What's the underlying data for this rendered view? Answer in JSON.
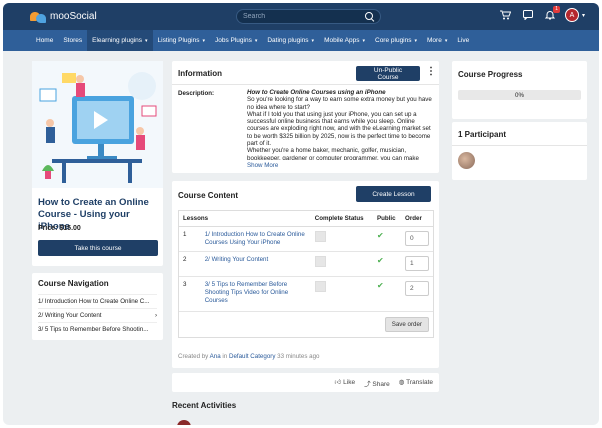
{
  "header": {
    "brand": "mooSocial",
    "search_placeholder": "Search",
    "notification_count": "1",
    "avatar_initial": "A"
  },
  "nav": [
    {
      "label": "Home",
      "caret": ""
    },
    {
      "label": "Stores",
      "caret": ""
    },
    {
      "label": "Elearning plugins",
      "caret": "▾",
      "active": true
    },
    {
      "label": "Listing Plugins",
      "caret": "▾"
    },
    {
      "label": "Jobs Plugins",
      "caret": "▾"
    },
    {
      "label": "Dating plugins",
      "caret": "▾"
    },
    {
      "label": "Mobile Apps",
      "caret": "▾"
    },
    {
      "label": "Core plugins",
      "caret": "▾"
    },
    {
      "label": "More",
      "caret": "▾"
    },
    {
      "label": "Live",
      "caret": ""
    }
  ],
  "course": {
    "title": "How to Create an Online Course - Using your iPhone",
    "price": "Price: $15.00",
    "take_button": "Take this course"
  },
  "course_navigation": {
    "title": "Course Navigation",
    "items": [
      "1/ Introduction How to Create Online C...",
      "2/ Writing Your Content",
      "3/ 5 Tips to Remember Before Shootin..."
    ]
  },
  "information": {
    "title": "Information",
    "unpublic_button": "Un-Public Course",
    "description_label": "Description:",
    "heading": "How to Create Online Courses using an iPhone",
    "paragraphs": [
      "So you're looking for a way to earn some extra money but you have no idea where to start?",
      "What if I told you that using just your iPhone, you can set up a successful online business that earns while you sleep. Online courses are exploding right now, and with the eLearning market set to be worth $325 billion by 2025, now is the perfect time to become part of it.",
      "Whether you're a home baker, mechanic, golfer, musician, bookkeeper, gardener or computer programmer, you can make"
    ],
    "show_more": "Show More"
  },
  "course_content": {
    "title": "Course Content",
    "create_button": "Create Lesson",
    "columns": [
      "Lessons",
      "Complete Status",
      "Public",
      "Order"
    ],
    "rows": [
      {
        "num": "1",
        "title": "1/ Introduction How to Create Online Courses Using Your iPhone",
        "order": "0"
      },
      {
        "num": "2",
        "title": "2/ Writing Your Content",
        "order": "1"
      },
      {
        "num": "3",
        "title": "3/ 5 Tips to Remember Before Shooting Tips Video for Online Courses",
        "order": "2"
      }
    ],
    "save_button": "Save order",
    "created_by_prefix": "Created by",
    "author": "Ana",
    "in_word": "in",
    "category": "Default Category",
    "time_ago": "33 minutes ago"
  },
  "actions": {
    "like": "Like",
    "share": "Share",
    "translate": "Translate"
  },
  "recent_activities": "Recent Activities",
  "progress": {
    "title": "Course Progress",
    "percent_label": "0%",
    "value": 0
  },
  "participants": {
    "title": "1 Participant"
  }
}
